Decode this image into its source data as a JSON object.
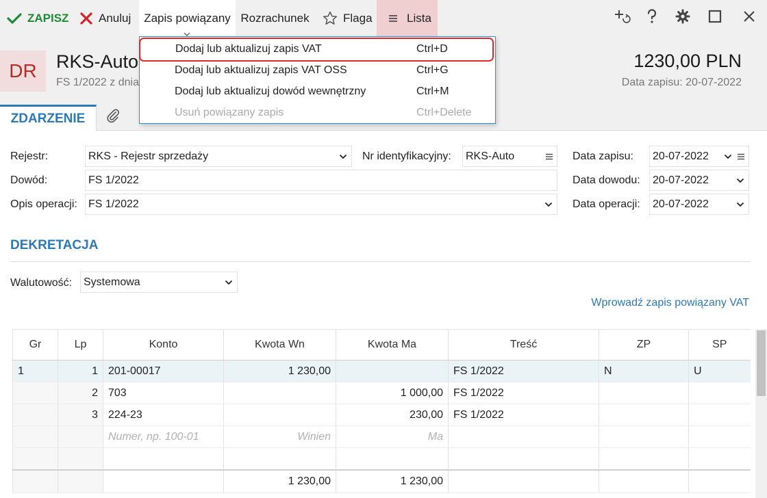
{
  "toolbar": {
    "save_label": "ZAPISZ",
    "cancel_label": "Anuluj",
    "linked_label": "Zapis powiązany",
    "settlement_label": "Rozrachunek",
    "flag_label": "Flaga",
    "list_label": "Lista",
    "icons": [
      "check-icon",
      "close-x-icon",
      "chevron-down-icon",
      "star-icon",
      "hamburger-icon",
      "add-linked-icon",
      "help-icon",
      "gear-icon",
      "maximize-icon",
      "close-icon"
    ],
    "colors": {
      "save": "#1e8a36",
      "cancel": "#d2232a",
      "list_bg": "#efcfcf"
    }
  },
  "header": {
    "badge": "DR",
    "title": "RKS-Auto",
    "subtitle": "FS 1/2022 z dnia",
    "amount": "1230,00 PLN",
    "record_date": "Data zapisu: 20-07-2022"
  },
  "tabs": {
    "event": "ZDARZENIE",
    "attachment_icon": "paperclip-icon"
  },
  "form": {
    "register_label": "Rejestr:",
    "register_value": "RKS - Rejestr sprzedaży",
    "id_label": "Nr identyfikacyjny:",
    "id_value": "RKS-Auto",
    "record_date_label": "Data zapisu:",
    "record_date_value": "20-07-2022",
    "proof_label": "Dowód:",
    "proof_value": "FS 1/2022",
    "proof_date_label": "Data dowodu:",
    "proof_date_value": "20-07-2022",
    "description_label": "Opis operacji:",
    "description_value": "FS 1/2022",
    "operation_date_label": "Data operacji:",
    "operation_date_value": "20-07-2022"
  },
  "decree": {
    "title": "DEKRETACJA",
    "currency_label": "Walutowość:",
    "currency_value": "Systemowa",
    "vat_link": "Wprowadź zapis powiązany VAT"
  },
  "table": {
    "headers": [
      "Gr",
      "Lp",
      "Konto",
      "Kwota Wn",
      "Kwota Ma",
      "Treść",
      "ZP",
      "SP"
    ],
    "rows": [
      [
        "1",
        "1",
        "201-00017",
        "1 230,00",
        "",
        "FS 1/2022",
        "N",
        "U"
      ],
      [
        "",
        "2",
        "703",
        "",
        "1 000,00",
        "FS 1/2022",
        "",
        ""
      ],
      [
        "",
        "3",
        "224-23",
        "",
        "230,00",
        "FS 1/2022",
        "",
        ""
      ]
    ],
    "placeholders": {
      "account": "Numer, np. 100-01",
      "debit": "Winien",
      "credit": "Ma"
    },
    "totals": {
      "debit": "1 230,00",
      "credit": "1 230,00"
    }
  },
  "menu": {
    "items": [
      {
        "label": "Dodaj lub aktualizuj zapis VAT",
        "shortcut": "Ctrl+D"
      },
      {
        "label": "Dodaj lub aktualizuj zapis VAT OSS",
        "shortcut": "Ctrl+G"
      },
      {
        "label": "Dodaj lub aktualizuj dowód wewnętrzny",
        "shortcut": "Ctrl+M"
      },
      {
        "label": "Usuń powiązany zapis",
        "shortcut": "Ctrl+Delete"
      }
    ]
  }
}
